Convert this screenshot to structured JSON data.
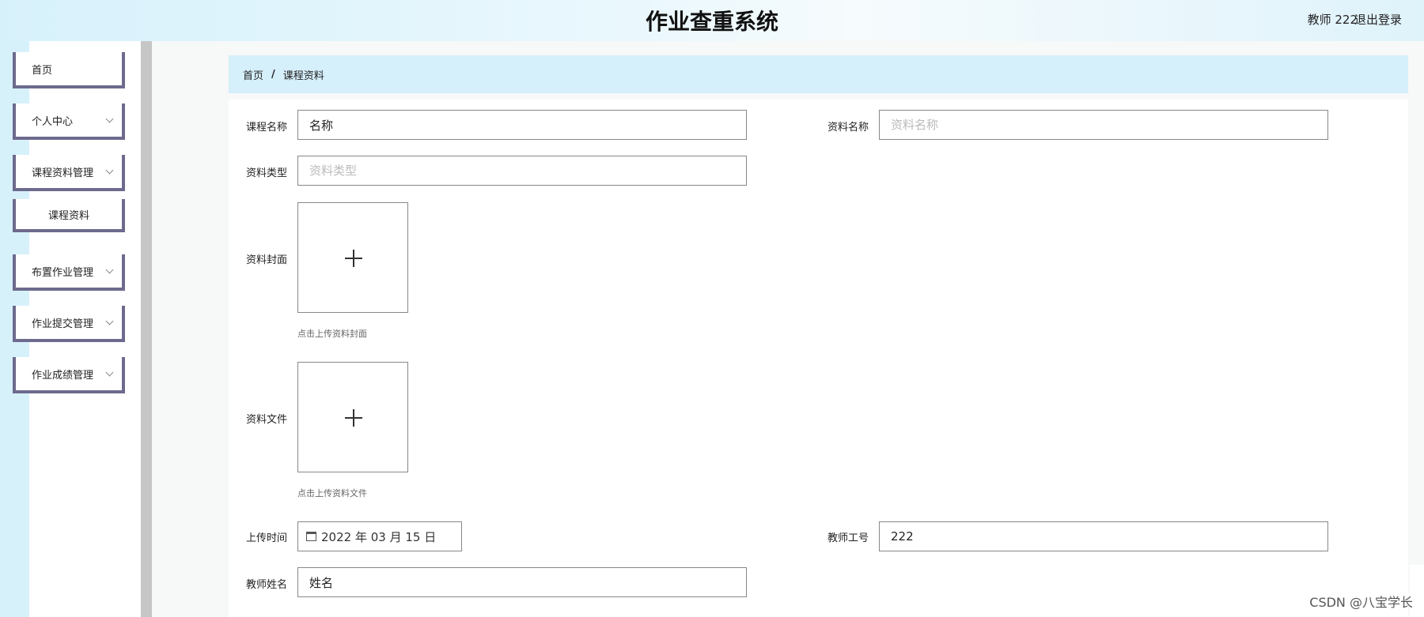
{
  "header": {
    "app_title": "作业查重系统",
    "user_label": "教师 222",
    "logout_label": "退出登录"
  },
  "sidebar": {
    "items": [
      {
        "label": "首页",
        "has_chevron": false
      },
      {
        "label": "个人中心",
        "has_chevron": true
      },
      {
        "label": "课程资料管理",
        "has_chevron": true
      },
      {
        "label": "课程资料",
        "submenu": true
      },
      {
        "label": "布置作业管理",
        "has_chevron": true
      },
      {
        "label": "作业提交管理",
        "has_chevron": true
      },
      {
        "label": "作业成绩管理",
        "has_chevron": true
      }
    ]
  },
  "breadcrumb": {
    "home": "首页",
    "separator": "/",
    "current": "课程资料"
  },
  "form": {
    "course_name": {
      "label": "课程名称",
      "value": "名称"
    },
    "material_name": {
      "label": "资料名称",
      "value": "",
      "placeholder": "资料名称"
    },
    "material_type": {
      "label": "资料类型",
      "value": "",
      "placeholder": "资料类型"
    },
    "cover": {
      "label": "资料封面",
      "hint": "点击上传资料封面"
    },
    "file": {
      "label": "资料文件",
      "hint": "点击上传资料文件"
    },
    "upload_time": {
      "label": "上传时间",
      "value": "2022 年 03 月 15 日"
    },
    "teacher_id": {
      "label": "教师工号",
      "value": "222"
    },
    "teacher_name": {
      "label": "教师姓名",
      "value": "姓名"
    }
  },
  "watermark": "CSDN @八宝学长",
  "colors": {
    "header_bg": "#d7f1fb",
    "breadcrumb_bg": "#d5effb",
    "menu_border": "#6d6a8e"
  }
}
